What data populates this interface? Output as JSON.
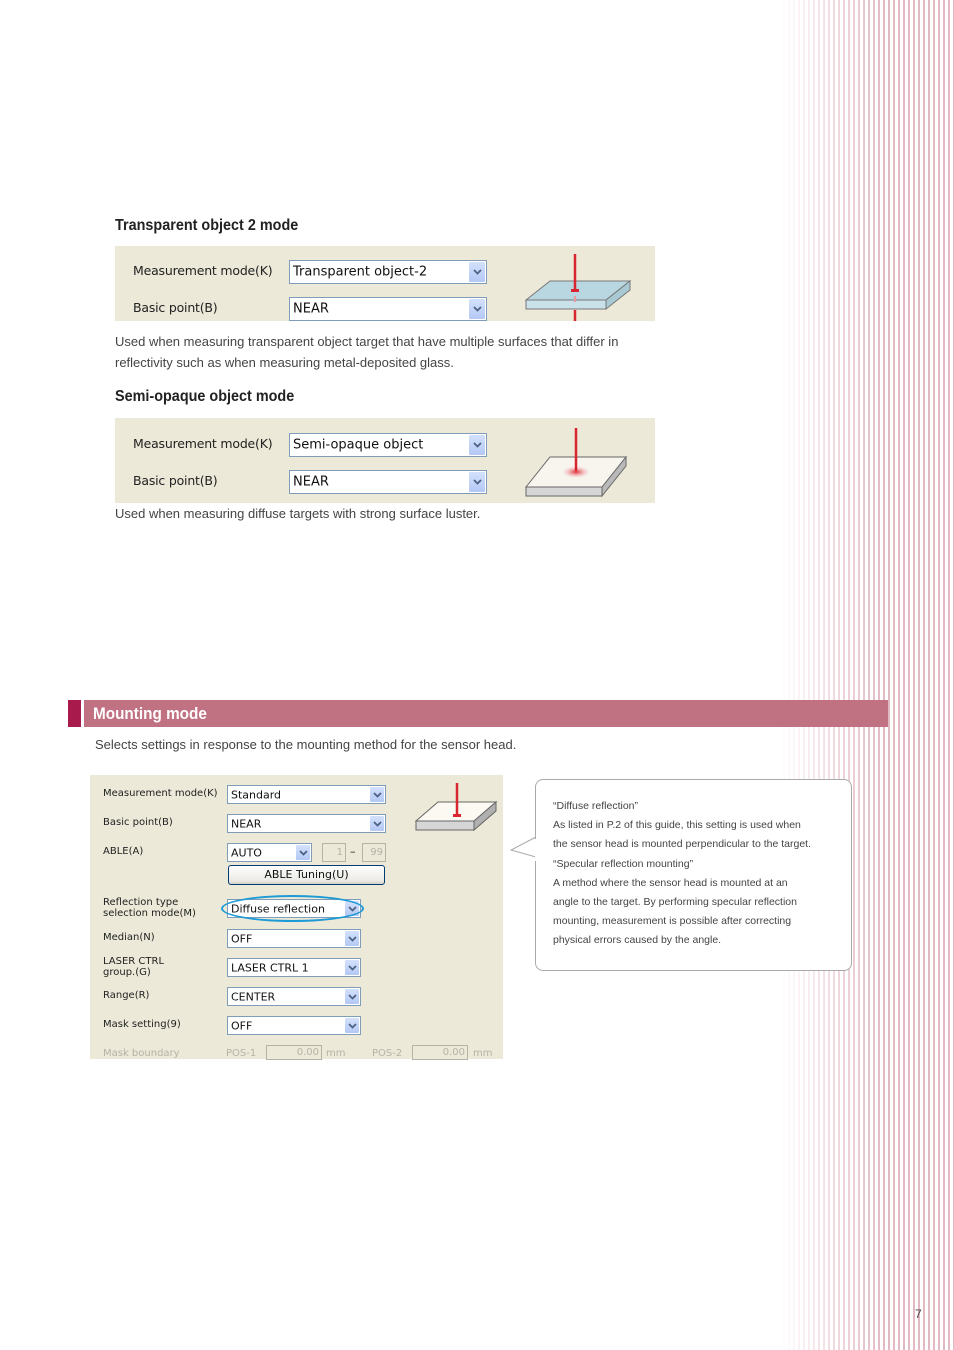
{
  "sections": {
    "transparent2": {
      "heading": "Transparent object 2 mode",
      "fields": [
        {
          "label": "Measurement mode(K)",
          "value": "Transparent object-2"
        },
        {
          "label": "Basic point(B)",
          "value": "NEAR"
        }
      ],
      "description": "Used when measuring transparent object target that have multiple surfaces that differ in reflectivity such as when measuring metal-deposited glass."
    },
    "semiopaque": {
      "heading": "Semi-opaque object mode",
      "fields": [
        {
          "label": "Measurement mode(K)",
          "value": "Semi-opaque object"
        },
        {
          "label": "Basic point(B)",
          "value": "NEAR"
        }
      ],
      "description": "Used when measuring diffuse targets with strong surface luster."
    }
  },
  "mounting": {
    "title": "Mounting mode",
    "intro": "Selects settings in response to the mounting method for the sensor head.",
    "settings": {
      "measurement_mode": {
        "label": "Measurement mode(K)",
        "value": "Standard"
      },
      "basic_point": {
        "label": "Basic point(B)",
        "value": "NEAR"
      },
      "able": {
        "label": "ABLE(A)",
        "value": "AUTO",
        "range_min": "1",
        "range_sep": "–",
        "range_max": "99"
      },
      "able_tuning_button": "ABLE Tuning(U)",
      "reflection_type": {
        "label_line1": "Reflection type",
        "label_line2": "selection mode(M)",
        "value": "Diffuse reflection"
      },
      "median": {
        "label": "Median(N)",
        "value": "OFF"
      },
      "laser_ctrl": {
        "label_line1": "LASER CTRL",
        "label_line2": "group.(G)",
        "value": "LASER CTRL 1"
      },
      "range": {
        "label": "Range(R)",
        "value": "CENTER"
      },
      "mask_setting": {
        "label": "Mask setting(9)",
        "value": "OFF"
      },
      "mask_boundary": {
        "label": "Mask boundary",
        "pos1_label": "POS-1",
        "pos1_value": "0.00",
        "pos1_unit": "mm",
        "pos2_label": "POS-2",
        "pos2_value": "0.00",
        "pos2_unit": "mm"
      }
    },
    "callout": [
      "“Diffuse reflection”",
      "As listed in P.2 of this guide, this setting is used when",
      "the sensor head is mounted perpendicular to the target.",
      "“Specular reflection mounting”",
      "A method where the sensor head is mounted at an",
      "angle to the target. By performing specular reflection",
      "mounting, measurement is possible after correcting",
      "physical errors caused by the angle."
    ]
  },
  "page_number": "7",
  "colors": {
    "section_bar": "#c07182",
    "section_accent": "#a8194c",
    "panel_bg": "#ece9d8",
    "highlight_ellipse": "#1e9ad6",
    "laser_red": "#d9252f"
  }
}
